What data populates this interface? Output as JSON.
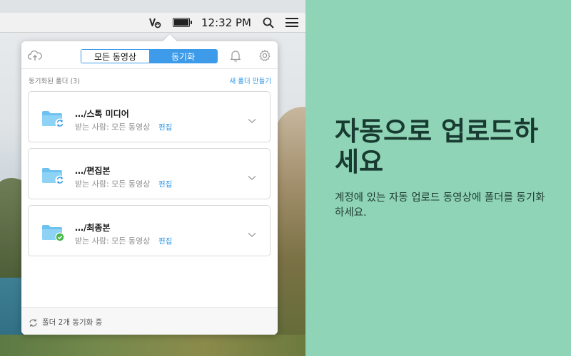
{
  "menubar": {
    "app_icon": "app-status-icon",
    "time": "12:32 PM",
    "search_icon": "search-icon",
    "list_icon": "list-icon"
  },
  "toolbar": {
    "segment_all": "모든 동영상",
    "segment_sync": "동기화",
    "upload_icon": "upload-cloud-icon",
    "bell_icon": "bell-icon",
    "gear_icon": "gear-icon"
  },
  "section": {
    "label": "동기화된 폴더 (3)",
    "new_folder": "새 폴더 만들기"
  },
  "folders": [
    {
      "name": "…/스톡 미디어",
      "recipient": "받는 사람: 모든 동영상",
      "edit": "편집",
      "status": "syncing"
    },
    {
      "name": "…/편집본",
      "recipient": "받는 사람: 모든 동영상",
      "edit": "편집",
      "status": "syncing"
    },
    {
      "name": "…/최종본",
      "recipient": "받는 사람: 모든 동영상",
      "edit": "편집",
      "status": "done"
    }
  ],
  "footer": {
    "status": "폴더 2개 동기화 중"
  },
  "promo": {
    "title": "자동으로 업로드하세요",
    "description": "계정에 있는 자동 업로드 동영상에 폴더를 동기화하세요."
  },
  "colors": {
    "accent": "#3d9bea",
    "background": "#8fd4b6",
    "sync_badge": "#2a95e6",
    "done_badge": "#46b94b"
  }
}
